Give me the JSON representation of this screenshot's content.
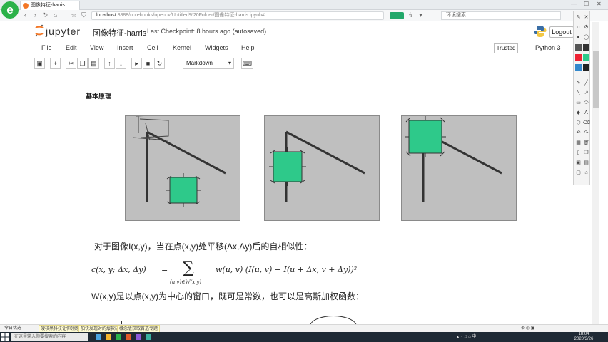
{
  "browser": {
    "tab_title": "图像特征-harris",
    "url_host": "localhost",
    "url_rest": "8888/notebooks/opencv/Untitled%20Folder/图像特征-harris.ipynb#",
    "search_placeholder": "环境搜索"
  },
  "header": {
    "jupyter_word": "jupyter",
    "notebook_title": "图像特征-harris",
    "checkpoint": "Last Checkpoint: 8 hours ago (autosaved)",
    "logout_label": "Logout"
  },
  "menu": {
    "items": [
      "File",
      "Edit",
      "View",
      "Insert",
      "Cell",
      "Kernel",
      "Widgets",
      "Help"
    ],
    "trusted": "Trusted",
    "kernel": "Python 3"
  },
  "toolbar": {
    "cell_type": "Markdown"
  },
  "content": {
    "heading": "基本原理",
    "formula_intro": "对于图像I(x,y)，当在点(x,y)处平移(Δx,Δy)后的自相似性：",
    "formula_lhs": "c(x, y; Δx, Δy)",
    "formula_eq": "=",
    "formula_sum": "∑",
    "formula_sub": "(u,v)∈W(x,y)",
    "formula_rhs": "w(u, v) (I(u, v) − I(u + Δx, v + Δy))²",
    "window_text": "W(x,y)是以点(x,y)为中心的窗口，既可是常数，也可以是高斯加权函数："
  },
  "statusbar": {
    "left": "今日优选",
    "notice1": "硬核黑科技让你领跑数据分析",
    "notice2": "加快发现对的爆款研究方向",
    "notice3": "概念版获取首选专题"
  },
  "taskbar": {
    "search": "在这里输入你要搜索的内容",
    "clock_time": "18:04",
    "clock_date": "2020/3/26"
  },
  "colors": {
    "window_green": "#2ec98a",
    "diagram_bg": "#bfbfbf",
    "accent_orange": "#f37726"
  }
}
